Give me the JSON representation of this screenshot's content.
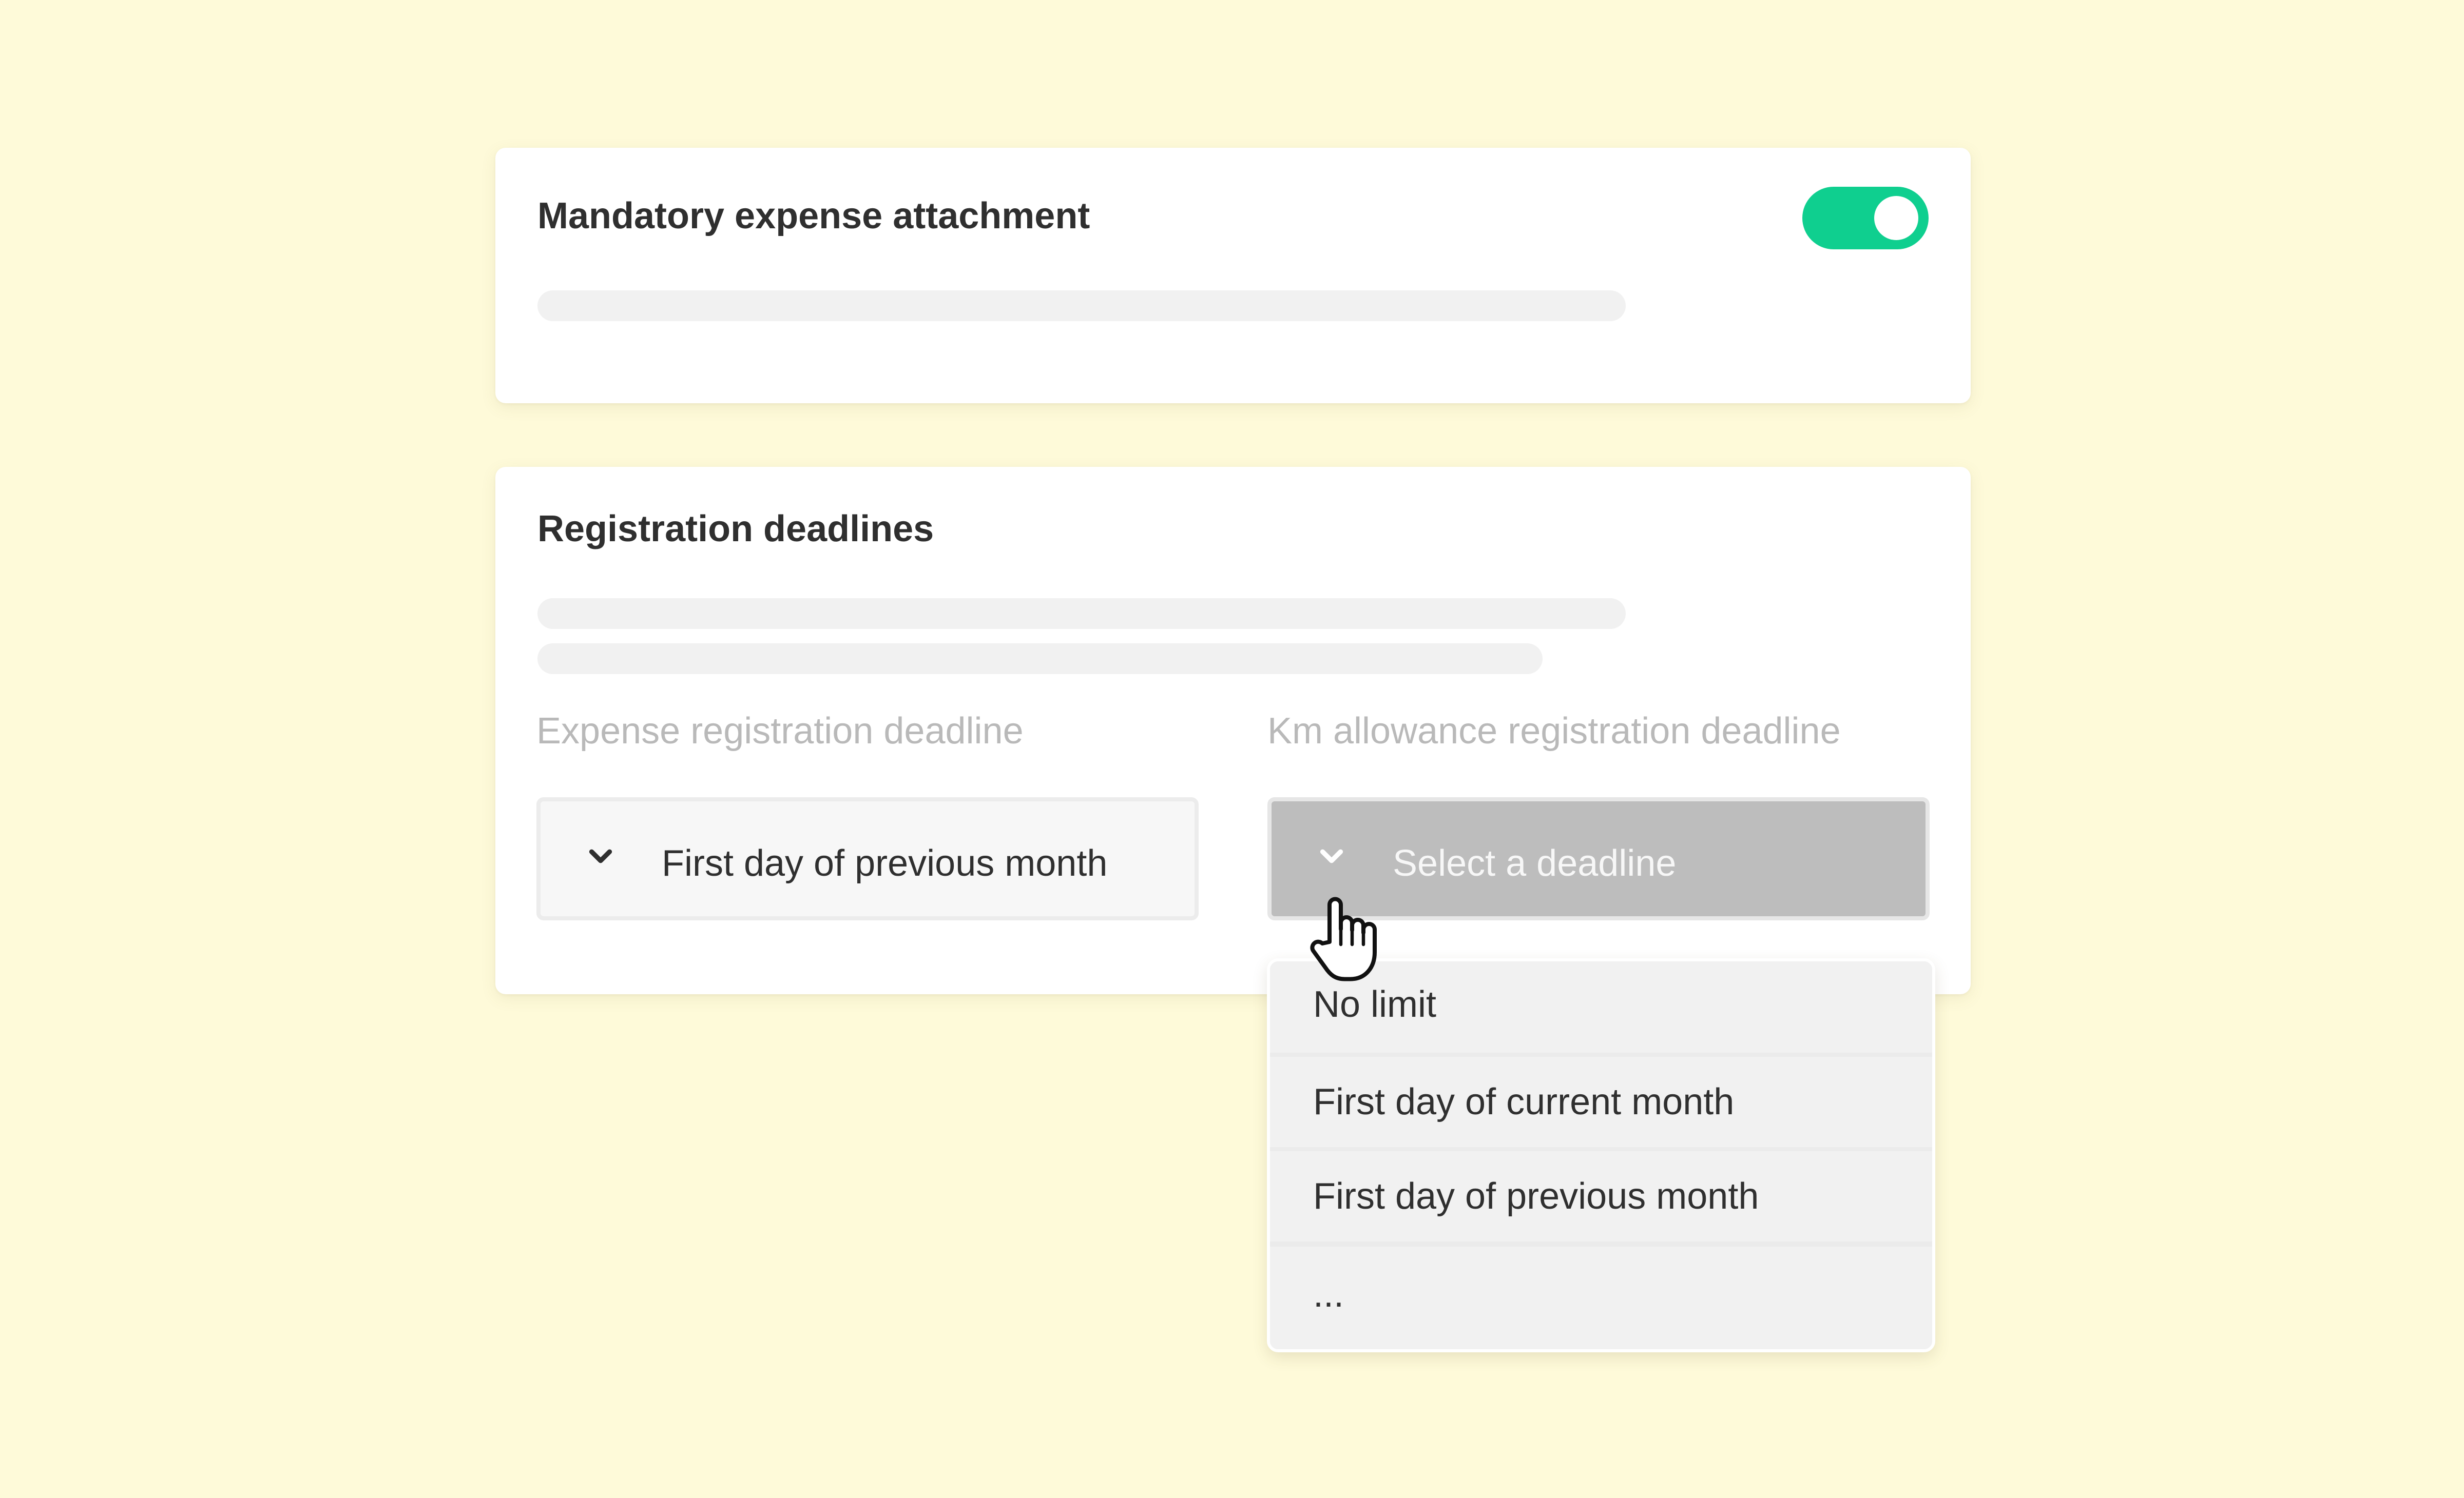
{
  "colors": {
    "background": "#fefad9",
    "toggle_on": "#0fcf8f",
    "skeleton": "#f1f1f1"
  },
  "attachment_card": {
    "title": "Mandatory expense attachment",
    "toggle_state": "on"
  },
  "deadlines_card": {
    "title": "Registration deadlines",
    "expense_field": {
      "label": "Expense registration deadline",
      "value": "First day of previous month",
      "icon": "chevron-down-icon"
    },
    "km_field": {
      "label": "Km allowance registration deadline",
      "placeholder": "Select a deadline",
      "icon": "chevron-down-icon"
    }
  },
  "dropdown": {
    "options": [
      {
        "label": "No limit"
      },
      {
        "label": "First day of current month"
      },
      {
        "label": "First day of previous month"
      },
      {
        "label": "..."
      }
    ]
  },
  "cursor": {
    "icon": "hand-pointer-icon"
  }
}
